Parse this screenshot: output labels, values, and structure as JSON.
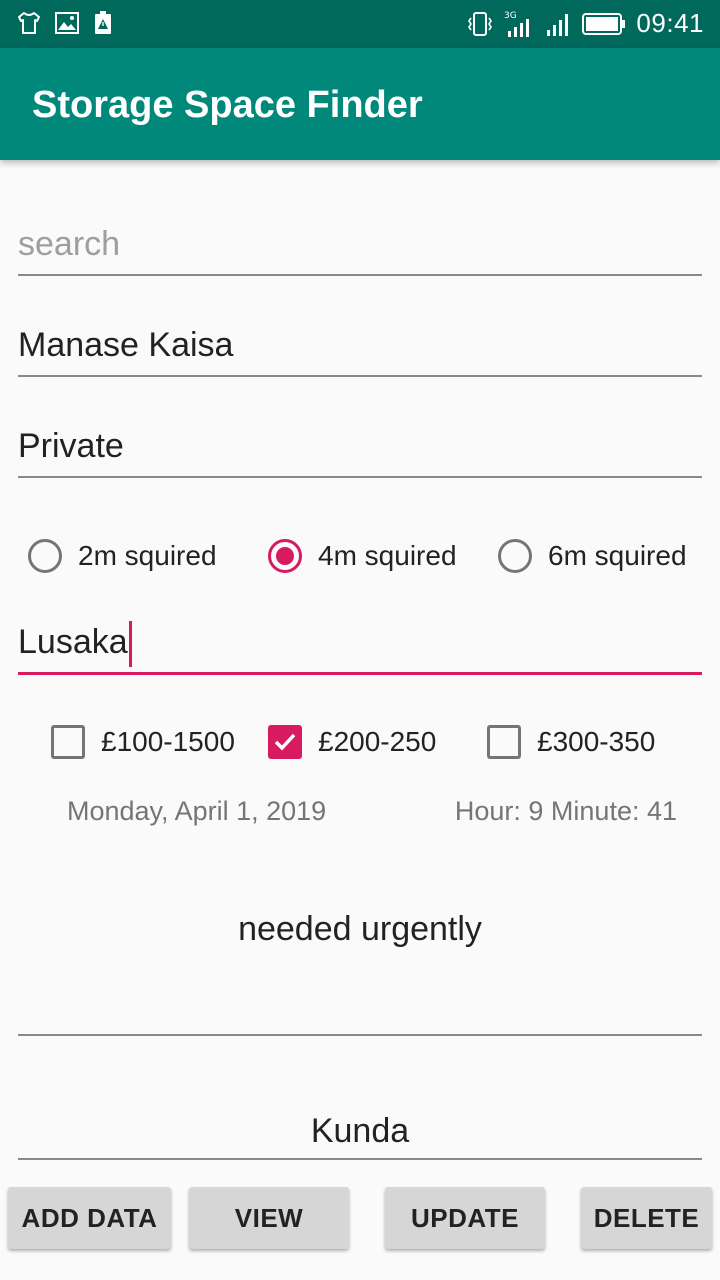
{
  "status_bar": {
    "time": "09:41",
    "network": "3G",
    "left_icons": [
      "tshirt-icon",
      "image-icon",
      "warning-icon"
    ],
    "right_icons": [
      "vibrate-icon",
      "signal-3g-icon",
      "signal-icon",
      "battery-icon"
    ]
  },
  "app": {
    "title": "Storage Space Finder"
  },
  "form": {
    "search": {
      "placeholder": "search",
      "value": ""
    },
    "name": {
      "value": "Manase Kaisa"
    },
    "type": {
      "value": "Private"
    },
    "size_options": [
      {
        "label": "2m squired",
        "selected": false
      },
      {
        "label": "4m squired",
        "selected": true
      },
      {
        "label": "6m squired",
        "selected": false
      }
    ],
    "location": {
      "value": "Lusaka"
    },
    "price_options": [
      {
        "label": "£100-1500",
        "checked": false
      },
      {
        "label": "£200-250",
        "checked": true
      },
      {
        "label": "£300-350",
        "checked": false
      }
    ],
    "date": "Monday, April 1, 2019",
    "time": "Hour: 9 Minute: 41",
    "notes": "needed urgently",
    "contact": "Kunda"
  },
  "buttons": {
    "add": "ADD DATA",
    "view": "VIEW",
    "update": "UPDATE",
    "delete": "DELETE"
  },
  "colors": {
    "status_bar": "#00695c",
    "app_bar": "#00897b",
    "accent": "#d81b60",
    "background": "#fafafa"
  }
}
